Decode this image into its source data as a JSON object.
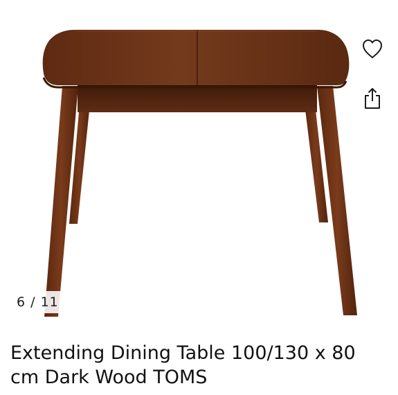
{
  "product": {
    "title": "Extending Dining Table 100/130 x 80 cm Dark Wood TOMS"
  },
  "gallery": {
    "counter": "6 / 11",
    "image_subject": "dark wood extending dining table"
  },
  "actions": {
    "favorite_icon": "heart-outline-icon",
    "share_icon": "share-icon"
  },
  "colors": {
    "wood_top": "#6e3519",
    "wood_dark": "#4f2410",
    "wood_leg": "#6b3117",
    "text": "#111111"
  }
}
